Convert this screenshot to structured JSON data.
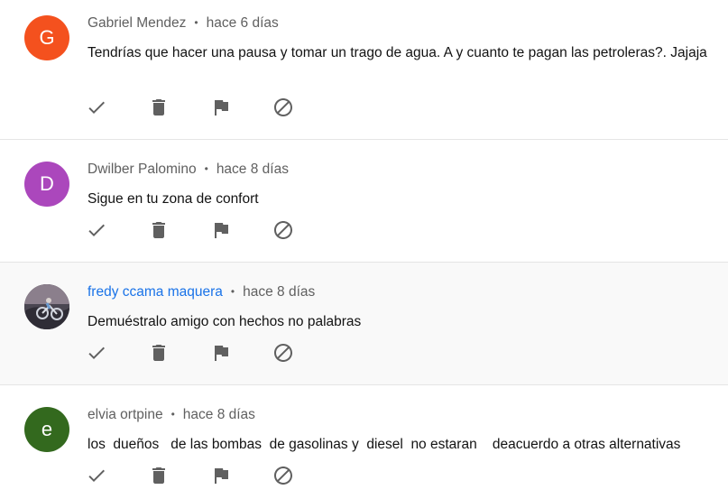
{
  "comments": [
    {
      "avatar_letter": "G",
      "avatar_color": "#f4511e",
      "author": "Gabriel Mendez",
      "time": "hace 6 días",
      "text": "Tendrías que hacer una pausa y tomar un trago de agua. A y cuanto te pagan las petroleras?. Jajaja"
    },
    {
      "avatar_letter": "D",
      "avatar_color": "#ab47bc",
      "author": "Dwilber Palomino",
      "time": "hace 8 días",
      "text": "Sigue en tu zona de confort"
    },
    {
      "avatar_letter": "",
      "avatar_color": "#4b4453",
      "author": "fredy ccama maquera",
      "author_color": "#1a73e8",
      "time": "hace 8 días",
      "text": "Demuéstralo amigo con hechos no palabras"
    },
    {
      "avatar_letter": "e",
      "avatar_color": "#33691e",
      "author": "elvia ortpine",
      "time": "hace 8 días",
      "text": "los  dueños   de las bombas  de gasolinas y  diesel  no estaran    deacuerdo a otras alternativas"
    }
  ],
  "actions": [
    "check-icon",
    "delete-icon",
    "flag-icon",
    "block-icon"
  ],
  "separator": "•"
}
